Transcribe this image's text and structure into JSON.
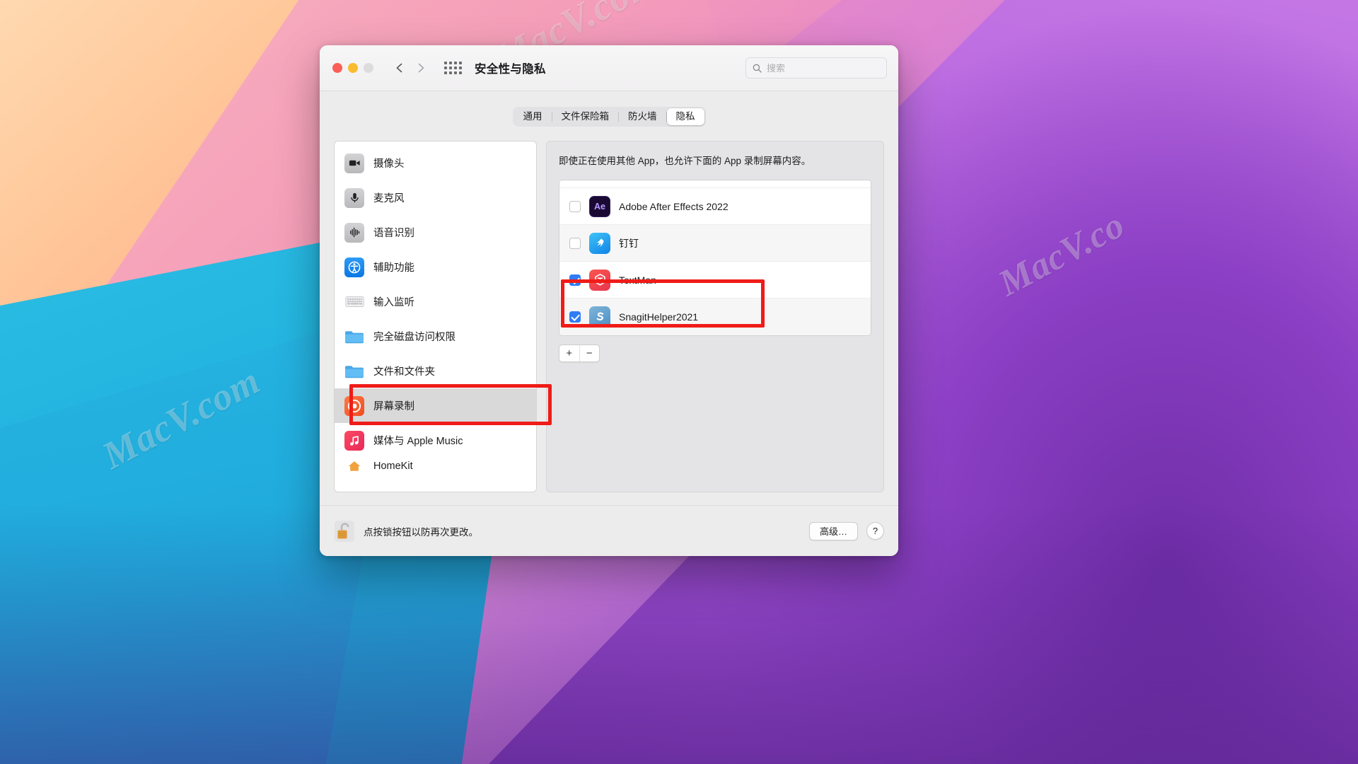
{
  "window": {
    "title": "安全性与隐私",
    "traffic_lights": [
      "close",
      "minimize",
      "zoom"
    ],
    "nav": {
      "back": "back-chevron",
      "forward": "forward-chevron"
    },
    "grid_icon": "show-all-grid-icon",
    "search": {
      "placeholder": "搜索",
      "value": "",
      "icon": "search-icon"
    }
  },
  "tabs": [
    {
      "label": "通用",
      "active": false
    },
    {
      "label": "文件保险箱",
      "active": false
    },
    {
      "label": "防火墙",
      "active": false
    },
    {
      "label": "隐私",
      "active": true
    }
  ],
  "sidebar": {
    "items": [
      {
        "label": "摄像头",
        "icon": "camera-icon",
        "selected": false
      },
      {
        "label": "麦克风",
        "icon": "microphone-icon",
        "selected": false
      },
      {
        "label": "语音识别",
        "icon": "speech-recognition-icon",
        "selected": false
      },
      {
        "label": "辅助功能",
        "icon": "accessibility-icon",
        "selected": false
      },
      {
        "label": "输入监听",
        "icon": "keyboard-input-monitoring-icon",
        "selected": false
      },
      {
        "label": "完全磁盘访问权限",
        "icon": "folder-icon",
        "selected": false
      },
      {
        "label": "文件和文件夹",
        "icon": "folder-icon",
        "selected": false
      },
      {
        "label": "屏幕录制",
        "icon": "screen-recording-icon",
        "selected": true
      },
      {
        "label": "媒体与 Apple Music",
        "icon": "music-note-icon",
        "selected": false
      },
      {
        "label": "HomeKit",
        "icon": "homekit-icon",
        "selected": false
      }
    ]
  },
  "right_pane": {
    "description": "即使正在使用其他 App，也允许下面的 App 录制屏幕内容。",
    "apps": [
      {
        "name": "Adobe After Effects 2022",
        "checked": false,
        "icon": "adobe-after-effects-icon",
        "badge_text": "Ae"
      },
      {
        "name": "钉钉",
        "checked": false,
        "icon": "dingtalk-icon",
        "badge_text": ""
      },
      {
        "name": "TextMan",
        "checked": true,
        "icon": "textman-icon",
        "badge_text": ""
      },
      {
        "name": "SnagitHelper2021",
        "checked": true,
        "icon": "snagit-icon",
        "badge_text": ""
      }
    ],
    "add_button": "+",
    "remove_button": "−"
  },
  "footer": {
    "lock_icon": "unlocked-padlock-icon",
    "lock_text": "点按锁按钮以防再次更改。",
    "advanced_button": "高级…",
    "help_button": "?"
  },
  "watermarks": [
    "MacV.com",
    "MacV.co",
    "MacV.com"
  ],
  "colors": {
    "accent_blue": "#2f7cf6",
    "annotation_red": "#ef1c18",
    "selected_row": "#d9d9d9",
    "window_bg": "#ececec"
  }
}
